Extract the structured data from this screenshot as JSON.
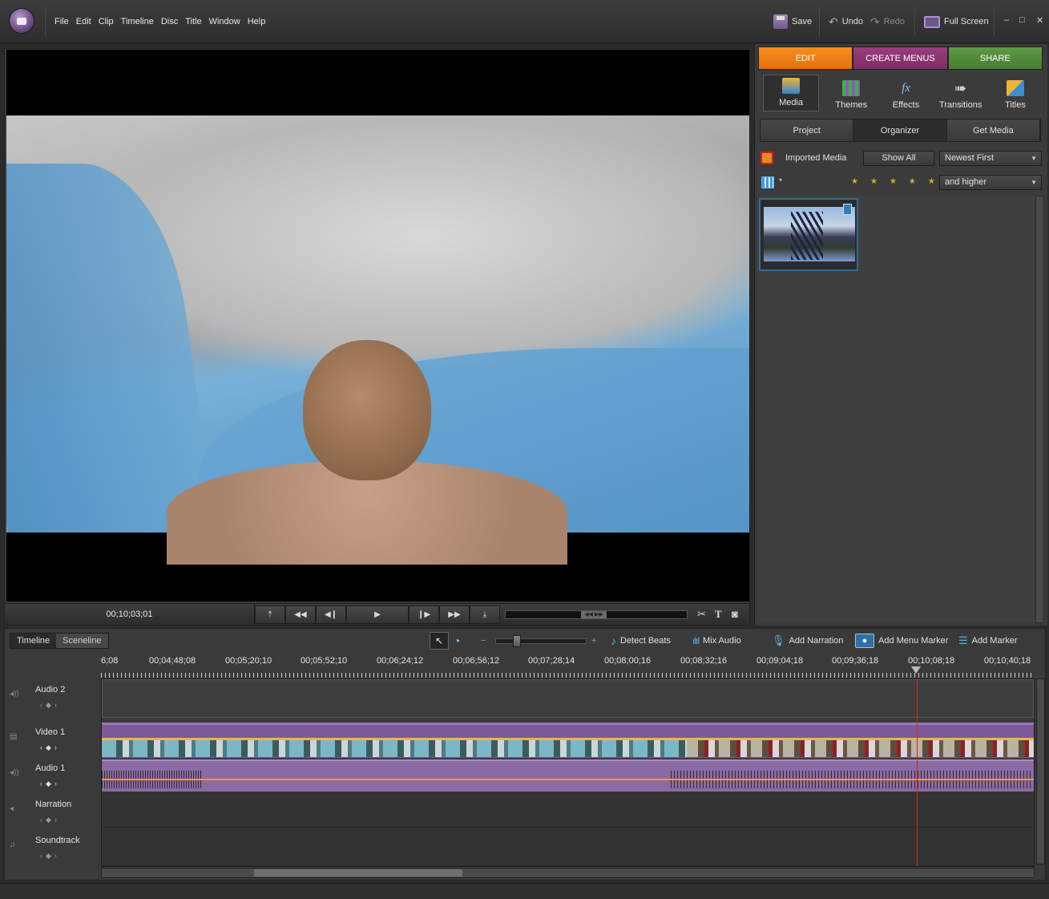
{
  "menu": [
    "File",
    "Edit",
    "Clip",
    "Timeline",
    "Disc",
    "Title",
    "Window",
    "Help"
  ],
  "toolbar": {
    "save": "Save",
    "undo": "Undo",
    "redo": "Redo",
    "fullscreen": "Full Screen"
  },
  "window_controls": [
    "–",
    "□",
    "✕"
  ],
  "monitor": {
    "timecode": "00;10;03;01"
  },
  "modes": {
    "edit": "EDIT",
    "menus": "CREATE MENUS",
    "share": "SHARE"
  },
  "tasks": [
    {
      "label": "Media",
      "icon": "media-icon",
      "active": true
    },
    {
      "label": "Themes",
      "icon": "themes-icon"
    },
    {
      "label": "Effects",
      "icon": "effects-icon"
    },
    {
      "label": "Transitions",
      "icon": "transitions-icon"
    },
    {
      "label": "Titles",
      "icon": "titles-icon"
    }
  ],
  "subtabs": {
    "project": "Project",
    "organizer": "Organizer",
    "get_media": "Get Media",
    "active": "Organizer"
  },
  "organizer": {
    "imported_label": "Imported Media",
    "show_all": "Show All",
    "sort": "Newest First",
    "rating_filter": "and higher"
  },
  "timeline": {
    "tabs": {
      "timeline": "Timeline",
      "sceneline": "Sceneline"
    },
    "tools": {
      "detect_beats": "Detect Beats",
      "mix_audio": "Mix Audio",
      "add_narration": "Add Narration",
      "add_menu_marker": "Add Menu Marker",
      "add_marker": "Add Marker",
      "zoom_minus": "−",
      "zoom_plus": "+"
    },
    "ruler": [
      "6;08",
      "00;04;48;08",
      "00;05;20;10",
      "00;05;52;10",
      "00;06;24;12",
      "00;06;56;12",
      "00;07;28;14",
      "00;08;00;16",
      "00;08;32;16",
      "00;09;04;18",
      "00;09;36;18",
      "00;10;08;18",
      "00;10;40;18"
    ],
    "tracks": [
      "Audio 2",
      "Video 1",
      "Audio 1",
      "Narration",
      "Soundtrack"
    ]
  },
  "colors": {
    "edit": "#f07e15",
    "menus": "#8a3371",
    "share": "#53893c",
    "playhead": "#dd2222",
    "clip": "#7b5a97"
  }
}
